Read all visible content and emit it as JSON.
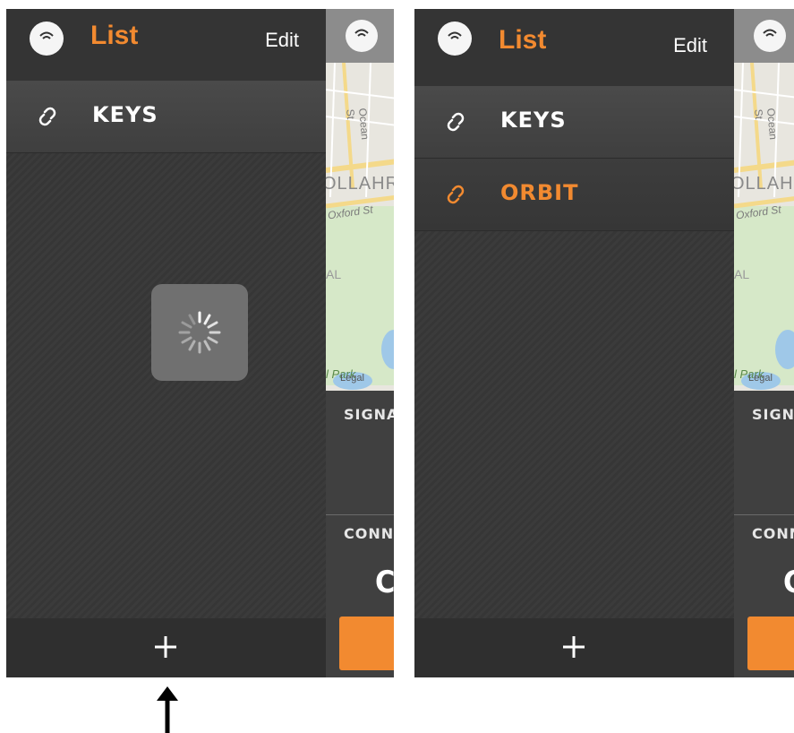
{
  "left_screen": {
    "header": {
      "title": "List",
      "edit_label": "Edit"
    },
    "items": [
      {
        "label": "KEYS",
        "color": "#ffffff"
      }
    ],
    "loading": true
  },
  "right_screen": {
    "header": {
      "title": "List",
      "edit_label": "Edit"
    },
    "items": [
      {
        "label": "KEYS",
        "color": "#ffffff"
      },
      {
        "label": "ORBIT",
        "color": "#f28a30"
      }
    ]
  },
  "side_panel": {
    "map_labels": {
      "street1": "Ocean St",
      "suburb": "OLLAHR",
      "street2": "Oxford St",
      "area": "AL",
      "park": "l Park",
      "legal": "Legal"
    },
    "signal_label": "SIGNA",
    "connection_label": "CONNE",
    "connection_value": "CO"
  },
  "colors": {
    "accent": "#f28a30",
    "background": "#3a3a3a"
  }
}
